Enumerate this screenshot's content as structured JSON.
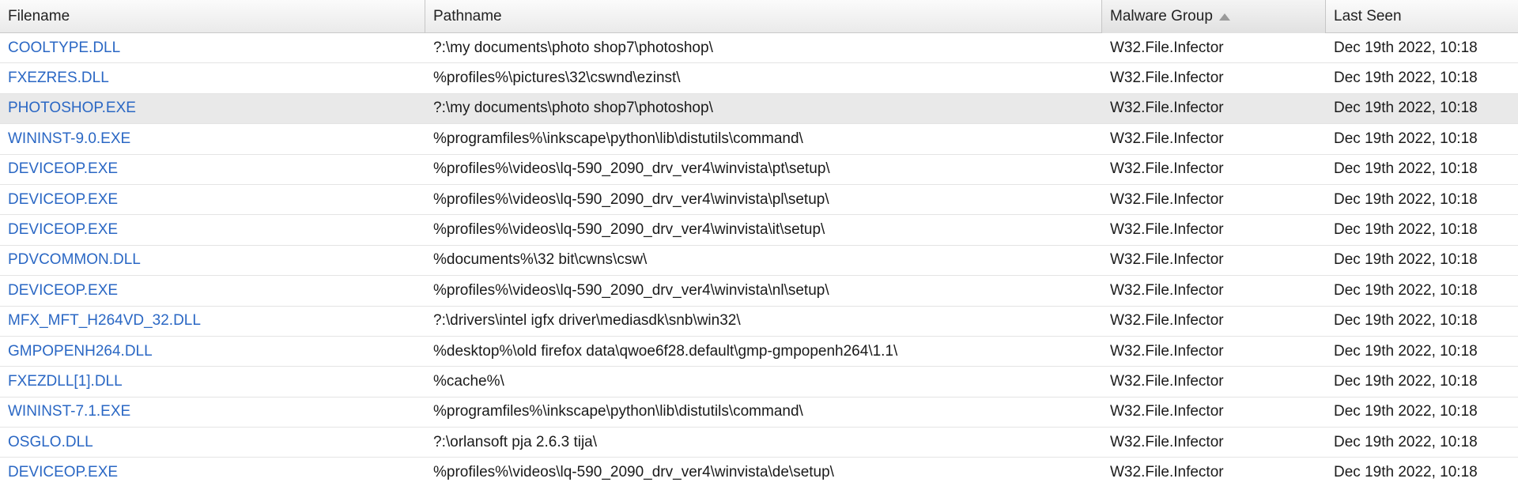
{
  "columns": {
    "filename": "Filename",
    "pathname": "Pathname",
    "malware_group": "Malware Group",
    "last_seen": "Last Seen"
  },
  "sort": {
    "column": "malware_group",
    "direction": "ascending",
    "icon": "sort-ascending-icon",
    "color": "#9a9a9a"
  },
  "colors": {
    "link": "#2a67c4",
    "selected_row": "#e9e9e9"
  },
  "rows": [
    {
      "filename": "COOLTYPE.DLL",
      "pathname": "?:\\my documents\\photo shop7\\photoshop\\",
      "malware_group": "W32.File.Infector",
      "last_seen": "Dec 19th 2022, 10:18"
    },
    {
      "filename": "FXEZRES.DLL",
      "pathname": "%profiles%\\pictures\\32\\cswnd\\ezinst\\",
      "malware_group": "W32.File.Infector",
      "last_seen": "Dec 19th 2022, 10:18"
    },
    {
      "filename": "PHOTOSHOP.EXE",
      "pathname": "?:\\my documents\\photo shop7\\photoshop\\",
      "malware_group": "W32.File.Infector",
      "last_seen": "Dec 19th 2022, 10:18"
    },
    {
      "filename": "WININST-9.0.EXE",
      "pathname": "%programfiles%\\inkscape\\python\\lib\\distutils\\command\\",
      "malware_group": "W32.File.Infector",
      "last_seen": "Dec 19th 2022, 10:18"
    },
    {
      "filename": "DEVICEOP.EXE",
      "pathname": "%profiles%\\videos\\lq-590_2090_drv_ver4\\winvista\\pt\\setup\\",
      "malware_group": "W32.File.Infector",
      "last_seen": "Dec 19th 2022, 10:18"
    },
    {
      "filename": "DEVICEOP.EXE",
      "pathname": "%profiles%\\videos\\lq-590_2090_drv_ver4\\winvista\\pl\\setup\\",
      "malware_group": "W32.File.Infector",
      "last_seen": "Dec 19th 2022, 10:18"
    },
    {
      "filename": "DEVICEOP.EXE",
      "pathname": "%profiles%\\videos\\lq-590_2090_drv_ver4\\winvista\\it\\setup\\",
      "malware_group": "W32.File.Infector",
      "last_seen": "Dec 19th 2022, 10:18"
    },
    {
      "filename": "PDVCOMMON.DLL",
      "pathname": "%documents%\\32 bit\\cwns\\csw\\",
      "malware_group": "W32.File.Infector",
      "last_seen": "Dec 19th 2022, 10:18"
    },
    {
      "filename": "DEVICEOP.EXE",
      "pathname": "%profiles%\\videos\\lq-590_2090_drv_ver4\\winvista\\nl\\setup\\",
      "malware_group": "W32.File.Infector",
      "last_seen": "Dec 19th 2022, 10:18"
    },
    {
      "filename": "MFX_MFT_H264VD_32.DLL",
      "pathname": "?:\\drivers\\intel igfx driver\\mediasdk\\snb\\win32\\",
      "malware_group": "W32.File.Infector",
      "last_seen": "Dec 19th 2022, 10:18"
    },
    {
      "filename": "GMPOPENH264.DLL",
      "pathname": "%desktop%\\old firefox data\\qwoe6f28.default\\gmp-gmpopenh264\\1.1\\",
      "malware_group": "W32.File.Infector",
      "last_seen": "Dec 19th 2022, 10:18"
    },
    {
      "filename": "FXEZDLL[1].DLL",
      "pathname": "%cache%\\",
      "malware_group": "W32.File.Infector",
      "last_seen": "Dec 19th 2022, 10:18"
    },
    {
      "filename": "WININST-7.1.EXE",
      "pathname": "%programfiles%\\inkscape\\python\\lib\\distutils\\command\\",
      "malware_group": "W32.File.Infector",
      "last_seen": "Dec 19th 2022, 10:18"
    },
    {
      "filename": "OSGLO.DLL",
      "pathname": "?:\\orlansoft pja 2.6.3 tija\\",
      "malware_group": "W32.File.Infector",
      "last_seen": "Dec 19th 2022, 10:18"
    },
    {
      "filename": "DEVICEOP.EXE",
      "pathname": "%profiles%\\videos\\lq-590_2090_drv_ver4\\winvista\\de\\setup\\",
      "malware_group": "W32.File.Infector",
      "last_seen": "Dec 19th 2022, 10:18"
    }
  ]
}
